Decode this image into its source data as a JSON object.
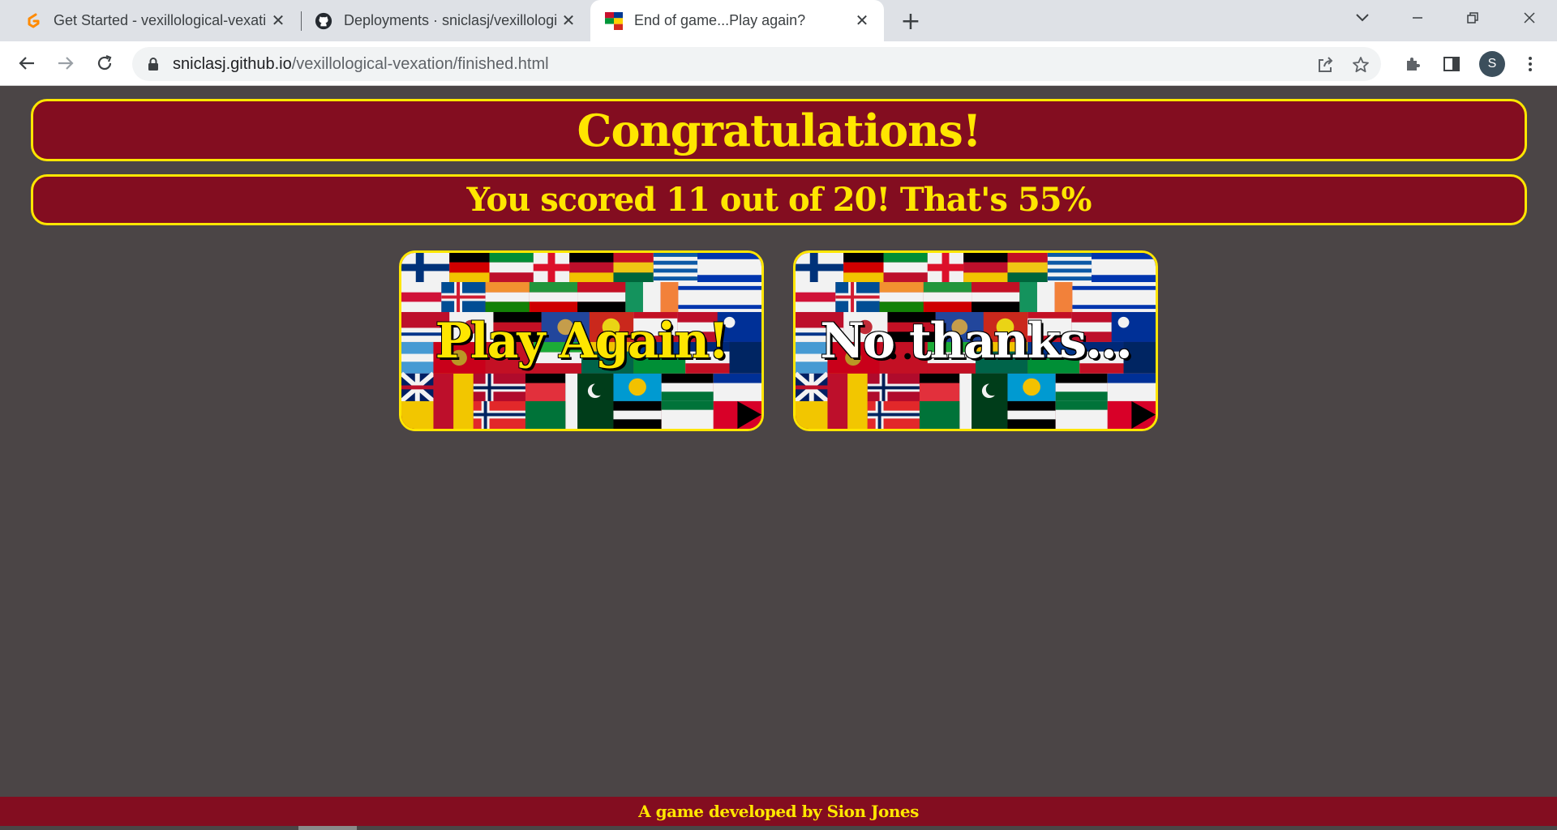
{
  "browser": {
    "tabs": [
      {
        "title": "Get Started - vexillological-vexati",
        "icon": "gitpod-icon",
        "active": false
      },
      {
        "title": "Deployments · sniclasj/vexillologi",
        "icon": "github-icon",
        "active": false
      },
      {
        "title": "End of game...Play again?",
        "icon": "flags-favicon",
        "active": true
      }
    ],
    "url_host": "sniclasj.github.io",
    "url_path": "/vexillological-vexation/finished.html",
    "profile_initial": "S"
  },
  "page": {
    "heading": "Congratulations!",
    "score_text": "You scored 11 out of 20! That's 55%",
    "play_again_label": "Play Again!",
    "no_thanks_label": "No thanks...",
    "footer_text": "A game developed by Sion Jones"
  },
  "colors": {
    "background": "#4b4546",
    "banner": "#830d20",
    "accent": "#ffe600"
  }
}
